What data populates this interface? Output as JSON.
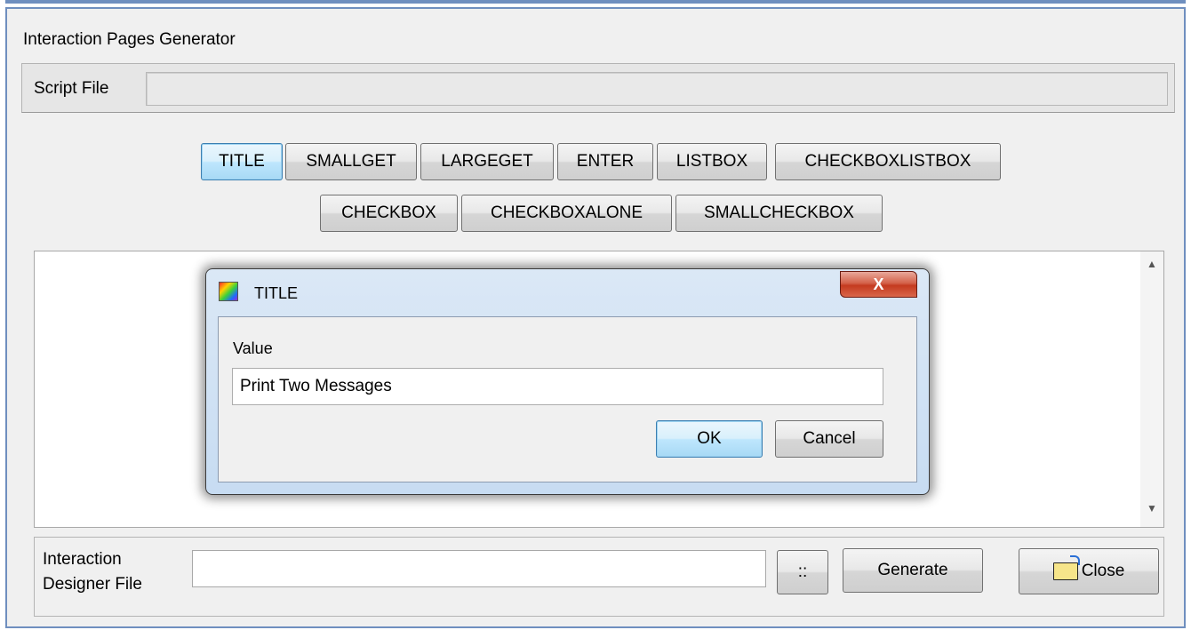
{
  "window": {
    "title": "Interaction Pages Generator"
  },
  "script_file": {
    "label": "Script File",
    "value": ""
  },
  "toolbar": {
    "row1": [
      "TITLE",
      "SMALLGET",
      "LARGEGET",
      "ENTER",
      "LISTBOX",
      "CHECKBOXLISTBOX"
    ],
    "row2": [
      "CHECKBOX",
      "CHECKBOXALONE",
      "SMALLCHECKBOX"
    ]
  },
  "scroll": {
    "up_icon": "scroll-up-arrow",
    "down_icon": "scroll-down-arrow",
    "up_glyph": "▲",
    "down_glyph": "▼"
  },
  "bottom": {
    "designer_label_line1": "Interaction",
    "designer_label_line2": "Designer File",
    "designer_value": "",
    "browse_label": "::",
    "generate_label": "Generate",
    "close_label": "Close"
  },
  "dialog": {
    "title": "TITLE",
    "close_glyph": "X",
    "value_label": "Value",
    "value": "Print Two Messages",
    "ok_label": "OK",
    "cancel_label": "Cancel"
  }
}
